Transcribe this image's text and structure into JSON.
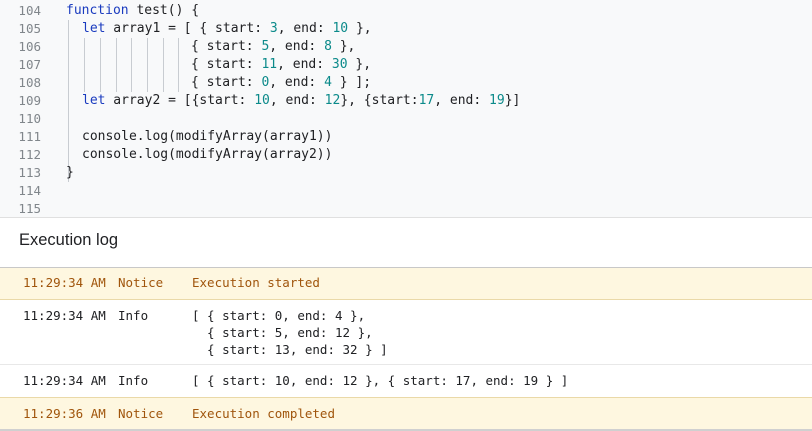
{
  "editor": {
    "line_numbers": [
      "104",
      "105",
      "106",
      "107",
      "108",
      "109",
      "110",
      "111",
      "112",
      "113",
      "114",
      "115"
    ],
    "code": {
      "l104": {
        "kw": "function",
        "rest": " test() {"
      },
      "l105": {
        "kw": "let",
        "a": " array1 = [ { start: ",
        "n1": "3",
        "b": ", end: ",
        "n2": "10",
        "c": " },"
      },
      "l106": {
        "a": "{ start: ",
        "n1": "5",
        "b": ", end: ",
        "n2": "8",
        "c": " },"
      },
      "l107": {
        "a": "{ start: ",
        "n1": "11",
        "b": ", end: ",
        "n2": "30",
        "c": " },"
      },
      "l108": {
        "a": "{ start: ",
        "n1": "0",
        "b": ", end: ",
        "n2": "4",
        "c": " } ];"
      },
      "l109": {
        "kw": "let",
        "a": " array2 = [{start: ",
        "n1": "10",
        "b": ", end: ",
        "n2": "12",
        "c": "}, {start:",
        "n3": "17",
        "d": ", end: ",
        "n4": "19",
        "e": "}]"
      },
      "l111": "console.log(modifyArray(array1))",
      "l112": "console.log(modifyArray(array2))",
      "l113": "}"
    }
  },
  "execution_log": {
    "title": "Execution log",
    "rows": [
      {
        "time": "11:29:34 AM",
        "level": "Notice",
        "message": "Execution started"
      },
      {
        "time": "11:29:34 AM",
        "level": "Info",
        "message_lines": [
          "[ { start: 0, end: 4 },",
          "  { start: 5, end: 12 },",
          "  { start: 13, end: 32 } ]"
        ]
      },
      {
        "time": "11:29:34 AM",
        "level": "Info",
        "message": "[ { start: 10, end: 12 }, { start: 17, end: 19 } ]"
      },
      {
        "time": "11:29:36 AM",
        "level": "Notice",
        "message": "Execution completed"
      }
    ]
  },
  "colors": {
    "keyword": "#1a3bbf",
    "number": "#0b8a8a",
    "notice_bg": "#fef7e0",
    "notice_text": "#a0550c"
  }
}
